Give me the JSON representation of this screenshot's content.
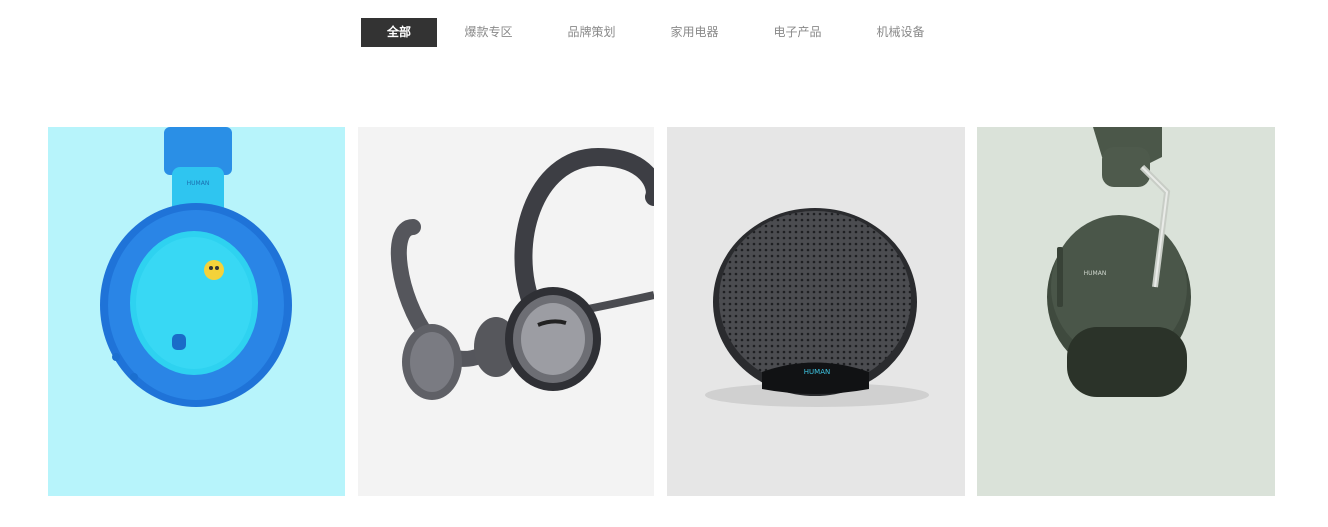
{
  "filter_tabs": [
    {
      "label": "全部",
      "active": true
    },
    {
      "label": "爆款专区",
      "active": false
    },
    {
      "label": "品牌策划",
      "active": false
    },
    {
      "label": "家用电器",
      "active": false
    },
    {
      "label": "电子产品",
      "active": false
    },
    {
      "label": "机械设备",
      "active": false
    }
  ],
  "products": [
    {
      "icon": "blue-kids-headphone-image",
      "background": "#b7f4fb",
      "brand_mark": "HUMAN"
    },
    {
      "icon": "bone-conduction-earphone-image",
      "background": "#f3f3f3"
    },
    {
      "icon": "round-bluetooth-speaker-image",
      "background": "#e6e6e6",
      "brand_mark": "HUMAN"
    },
    {
      "icon": "green-headphone-image",
      "background": "#dae2d9",
      "brand_mark": "HUMAN"
    }
  ]
}
